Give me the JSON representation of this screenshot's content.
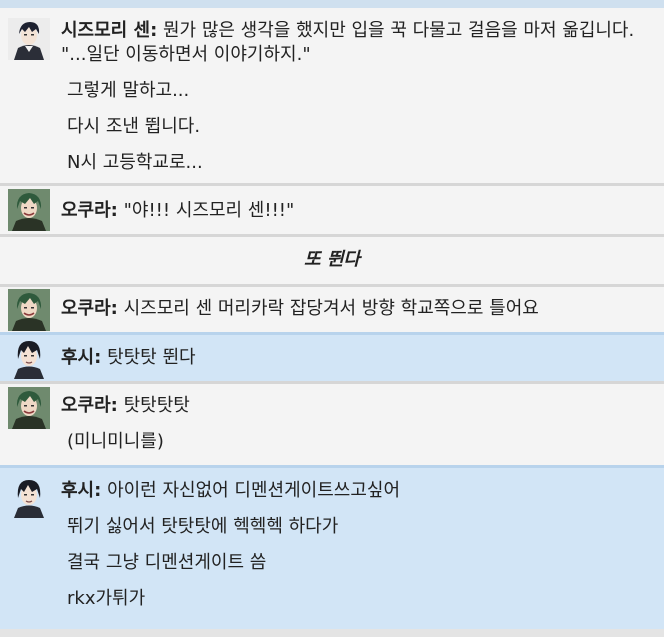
{
  "messages": [
    {
      "speaker": "시즈모리 센:",
      "avatar": "shizumori-avatar",
      "first": "뭔가 많은 생각을 했지만 입을 꾹 다물고 걸음을 마저 옮깁니다. \"...일단 이동하면서 이야기하지.\"",
      "lines": [
        "그렇게 말하고...",
        "다시 조낸 뜁니다.",
        "N시 고등학교로..."
      ]
    },
    {
      "speaker": "오쿠라:",
      "avatar": "okura-avatar",
      "first": "\"야!!! 시즈모리 센!!!\""
    },
    {
      "action": "또 뛴다"
    },
    {
      "speaker": "오쿠라:",
      "avatar": "okura-avatar",
      "first": "시즈모리 센 머리카락 잡당겨서 방향 학교쪽으로 틀어요"
    },
    {
      "speaker": "후시:",
      "avatar": "fushi-avatar",
      "first": "탓탓탓 뛴다"
    },
    {
      "speaker": "오쿠라:",
      "avatar": "okura-avatar",
      "first": "탓탓탓탓",
      "lines": [
        "(미니미니를)"
      ]
    },
    {
      "speaker": "후시:",
      "avatar": "fushi-avatar",
      "first": "아이런 자신없어 디멘션게이트쓰고싶어",
      "lines": [
        "뛰기 싫어서 탓탓탓에 헥헥헥 하다가",
        "결국 그냥 디멘션게이트 씀",
        "rkx가튀가"
      ]
    }
  ],
  "colors": {
    "grey_bg": "#f4f4f4",
    "blue_bg": "#d2e5f6",
    "divider": "#d6d6d6"
  }
}
